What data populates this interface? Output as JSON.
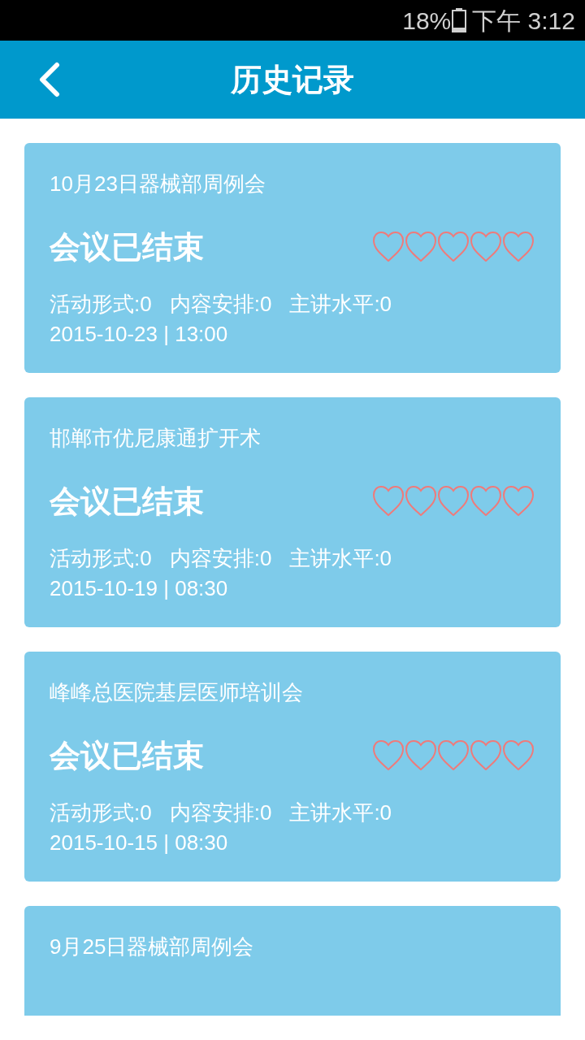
{
  "status_bar": {
    "battery": "18%",
    "time": "下午 3:12"
  },
  "header": {
    "title": "历史记录"
  },
  "meetings": [
    {
      "title": "10月23日器械部周例会",
      "status": "会议已结束",
      "stars": 0,
      "ratings": [
        "活动形式:0",
        "内容安排:0",
        "主讲水平:0"
      ],
      "datetime": "2015-10-23 | 13:00"
    },
    {
      "title": "邯郸市优尼康通扩开术",
      "status": "会议已结束",
      "stars": 0,
      "ratings": [
        "活动形式:0",
        "内容安排:0",
        "主讲水平:0"
      ],
      "datetime": "2015-10-19 | 08:30"
    },
    {
      "title": "峰峰总医院基层医师培训会",
      "status": "会议已结束",
      "stars": 0,
      "ratings": [
        "活动形式:0",
        "内容安排:0",
        "主讲水平:0"
      ],
      "datetime": "2015-10-15 | 08:30"
    },
    {
      "title": "9月25日器械部周例会"
    }
  ]
}
